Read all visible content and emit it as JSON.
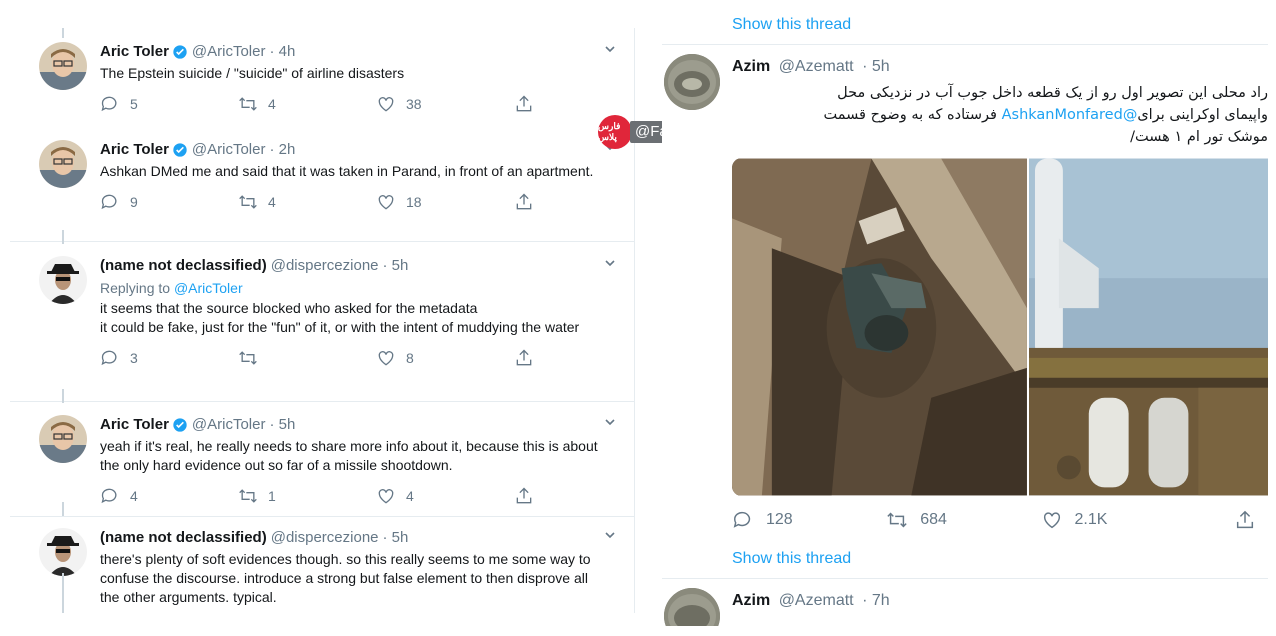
{
  "left_thread": {
    "tweets": [
      {
        "name": "Aric Toler",
        "verified": true,
        "handle": "@AricToler",
        "time": "· 4h",
        "reply_prefix": "",
        "reply_to": "",
        "body": "The Epstein suicide / \"suicide\" of airline disasters",
        "replies": "5",
        "retweets": "4",
        "likes": "38"
      },
      {
        "name": "Aric Toler",
        "verified": true,
        "handle": "@AricToler",
        "time": "· 2h",
        "reply_prefix": "",
        "reply_to": "",
        "body": "Ashkan DMed me and said that it was taken in Parand, in front of an apartment.",
        "replies": "9",
        "retweets": "4",
        "likes": "18"
      },
      {
        "name": "(name not declassified)",
        "verified": false,
        "handle": "@dispercezione",
        "time": "· 5h",
        "reply_prefix": "Replying to",
        "reply_to": "@AricToler",
        "body": "it seems that the source blocked who asked for the metadata\nit could be fake, just for the \"fun\" of it, or with the intent of muddying the water",
        "replies": "3",
        "retweets": "",
        "likes": "8"
      },
      {
        "name": "Aric Toler",
        "verified": true,
        "handle": "@AricToler",
        "time": "· 5h",
        "reply_prefix": "",
        "reply_to": "",
        "body": "yeah if it's real, he really needs to share more info about it, because this is about the only hard evidence out so far of a missile shootdown.",
        "replies": "4",
        "retweets": "1",
        "likes": "4"
      },
      {
        "name": "(name not declassified)",
        "verified": false,
        "handle": "@dispercezione",
        "time": "· 5h",
        "reply_prefix": "",
        "reply_to": "",
        "body": "there's plenty of soft evidences though. so this really seems to me some way to confuse the discourse. introduce a strong but false element to then disprove all the other arguments. typical.",
        "replies": "",
        "retweets": "",
        "likes": ""
      }
    ]
  },
  "watermark": {
    "label": "@Fars_plus",
    "logo_text": "فارس پلاس"
  },
  "right_feed": {
    "show_thread_top": "Show this thread",
    "tweet1": {
      "name": "Azim",
      "handle": "@Azematt",
      "time": "· 5h",
      "line1": "راد محلی این تصویر اول رو  از یک قطعه داخل جوب آب در نزدیکی محل",
      "line2_pre": "واپیمای اوکراینی برای",
      "line2_link": "@AshkanMonfared",
      "line2_post": "فرستاده که به وضوح قسمت",
      "line3": "موشک تور ام ۱ هست/",
      "replies": "128",
      "retweets": "684",
      "likes": "2.1K"
    },
    "show_thread_bottom": "Show this thread",
    "tweet2": {
      "name": "Azim",
      "handle": "@Azematt",
      "time": "· 7h"
    }
  },
  "colors": {
    "accent": "#1da1f2",
    "muted": "#657786",
    "watermark_red": "#e0263a"
  }
}
